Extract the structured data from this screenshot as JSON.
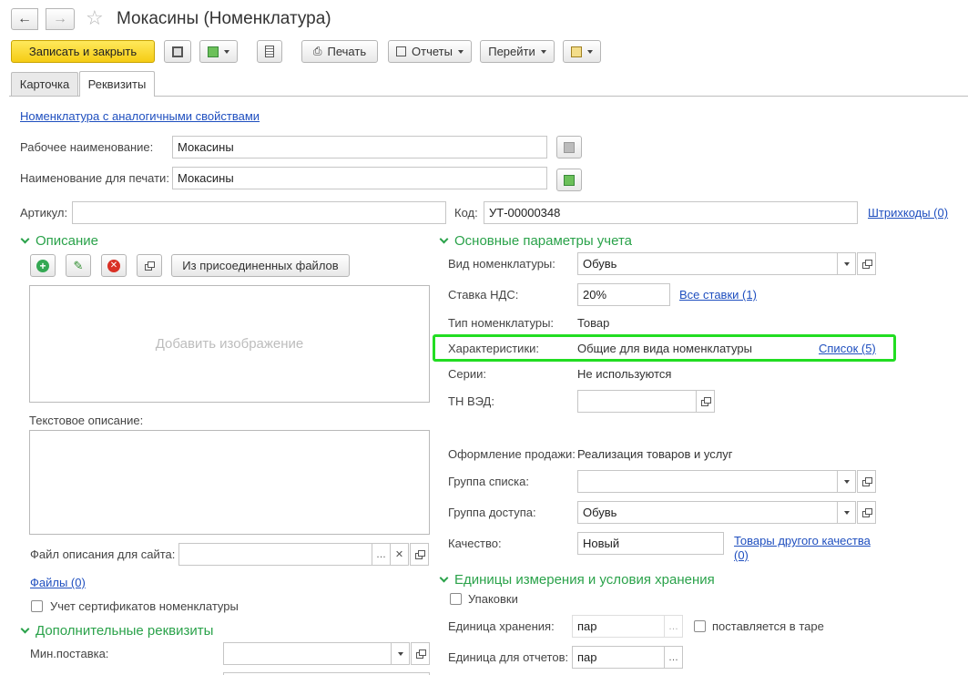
{
  "window": {
    "title": "Мокасины (Номенклатура)"
  },
  "toolbar": {
    "save_close": "Записать и закрыть",
    "print": "Печать",
    "reports": "Отчеты",
    "goto": "Перейти"
  },
  "tabs": [
    {
      "label": "Карточка"
    },
    {
      "label": "Реквизиты"
    }
  ],
  "similar_link": "Номенклатура с аналогичными свойствами",
  "working_name": {
    "label": "Рабочее наименование:",
    "value": "Мокасины"
  },
  "print_name": {
    "label": "Наименование для печати:",
    "value": "Мокасины"
  },
  "article": {
    "label": "Артикул:",
    "value": ""
  },
  "code": {
    "label": "Код:",
    "value": "УТ-00000348"
  },
  "barcodes_link": "Штрихкоды (0)",
  "description": {
    "title": "Описание",
    "from_files_btn": "Из присоединенных файлов",
    "add_image": "Добавить изображение",
    "text_label": "Текстовое описание:",
    "site_file_label": "Файл описания для сайта:",
    "site_file_value": "",
    "files_link": "Файлы (0)",
    "certificates": "Учет сертификатов номенклатуры"
  },
  "extra": {
    "title": "Дополнительные реквизиты",
    "min_supply_label": "Мин.поставка:",
    "min_supply_value": ""
  },
  "accounting": {
    "title": "Основные параметры учета",
    "kind_label": "Вид номенклатуры:",
    "kind_value": "Обувь",
    "vat_label": "Ставка НДС:",
    "vat_value": "20%",
    "all_rates_link": "Все ставки (1)",
    "type_label": "Тип номенклатуры:",
    "type_value": "Товар",
    "chars_label": "Характеристики:",
    "chars_value": "Общие для вида номенклатуры",
    "chars_link": "Список (5)",
    "series_label": "Серии:",
    "series_value": "Не используются",
    "tnved_label": "ТН ВЭД:",
    "tnved_value": "",
    "sale_label": "Оформление продажи:",
    "sale_value": "Реализация товаров и услуг",
    "list_group_label": "Группа списка:",
    "list_group_value": "",
    "access_group_label": "Группа доступа:",
    "access_group_value": "Обувь",
    "quality_label": "Качество:",
    "quality_value": "Новый",
    "other_quality_link_1": "Товары другого качества",
    "other_quality_link_2": "(0)"
  },
  "units": {
    "title": "Единицы измерения и условия хранения",
    "packages": "Упаковки",
    "storage_label": "Единица хранения:",
    "storage_value": "пар",
    "tare": "поставляется в таре",
    "reports_label": "Единица для отчетов:",
    "reports_value": "пар"
  },
  "colors": {
    "accent_green": "#2aa24a",
    "highlight": "#22dd22",
    "link": "#1f4fbf"
  }
}
